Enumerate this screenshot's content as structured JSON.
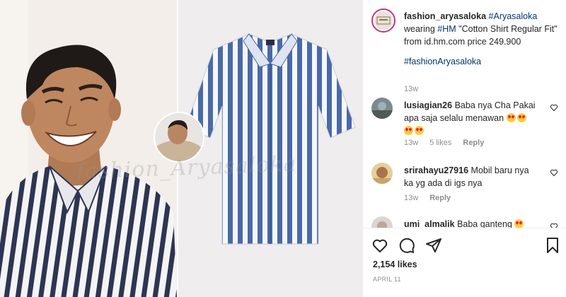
{
  "post": {
    "image": {
      "watermark": "fashion_Aryasaloka"
    },
    "caption": {
      "username": "fashion_aryasaloka",
      "hashtag_main": "#Aryasaloka",
      "text_wearing": "wearing",
      "hashtag_brand": "#HM",
      "text_rest": "\"Cotton Shirt Regular Fit\" from id.hm.com price 249.900",
      "hashtag_footer": "#fashionAryasaloka",
      "time": "13w"
    },
    "comments": [
      {
        "username": "lusiagian26",
        "text": "Baba nya Cha Pakai apa saja selalu menawan",
        "time": "13w",
        "likes": "5 likes",
        "reply_label": "Reply"
      },
      {
        "username": "srirahayu27916",
        "text": "Mobil baru nya ka yg ada di igs nya",
        "time": "13w",
        "reply_label": "Reply"
      },
      {
        "username": "umi_almalik",
        "text": "Baba ganteng"
      }
    ],
    "likes_count": "2,154 likes",
    "date": "APRIL 11"
  },
  "icons": {
    "like": "heart-icon",
    "comment": "comment-icon",
    "share": "share-icon",
    "save": "bookmark-icon"
  },
  "colors": {
    "hashtag": "#00376b",
    "meta_text": "#8e8e8e",
    "stripe_blue": "#4a6aa8"
  }
}
